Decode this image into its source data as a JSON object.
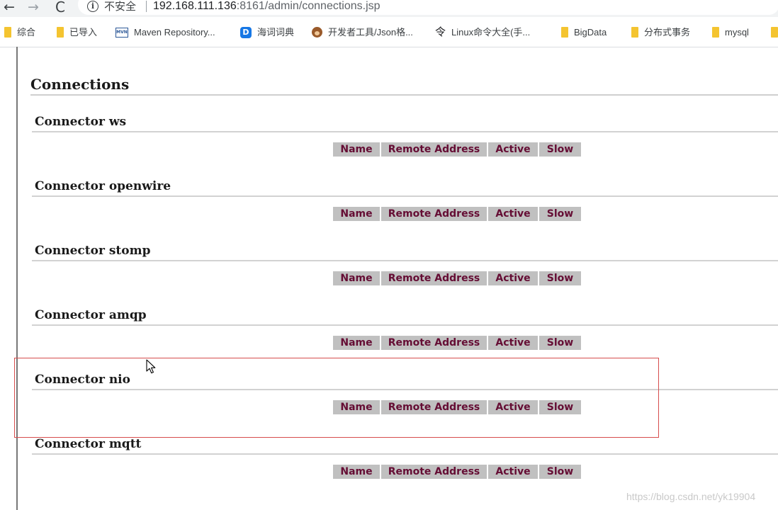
{
  "browser": {
    "back_glyph": "←",
    "forward_glyph": "→",
    "reload_glyph": "C",
    "info_glyph": "i",
    "insecure_label": "不安全",
    "url_host": "192.168.111.136",
    "url_rest": ":8161/admin/connections.jsp"
  },
  "bookmarks": [
    {
      "label": "综合"
    },
    {
      "label": "已导入"
    },
    {
      "label": "Maven Repository...",
      "icon_text": "MVN"
    },
    {
      "label": "海词词典",
      "icon_text": "D"
    },
    {
      "label": "开发者工具/Json格..."
    },
    {
      "label": "Linux命令大全(手...",
      "icon_glyph": "令"
    },
    {
      "label": "BigData"
    },
    {
      "label": "分布式事务"
    },
    {
      "label": "mysql"
    }
  ],
  "page": {
    "title": "Connections",
    "table_headers": [
      "Name",
      "Remote Address",
      "Active",
      "Slow"
    ],
    "connectors": [
      {
        "title": "Connector ws"
      },
      {
        "title": "Connector openwire"
      },
      {
        "title": "Connector stomp"
      },
      {
        "title": "Connector amqp"
      },
      {
        "title": "Connector nio"
      },
      {
        "title": "Connector mqtt"
      }
    ]
  },
  "watermark": "https://blog.csdn.net/yk19904",
  "colors": {
    "header_text": "#650d34",
    "header_bg": "#c0c0c0",
    "highlight_border": "#d64d4d",
    "folder": "#f4c430"
  }
}
